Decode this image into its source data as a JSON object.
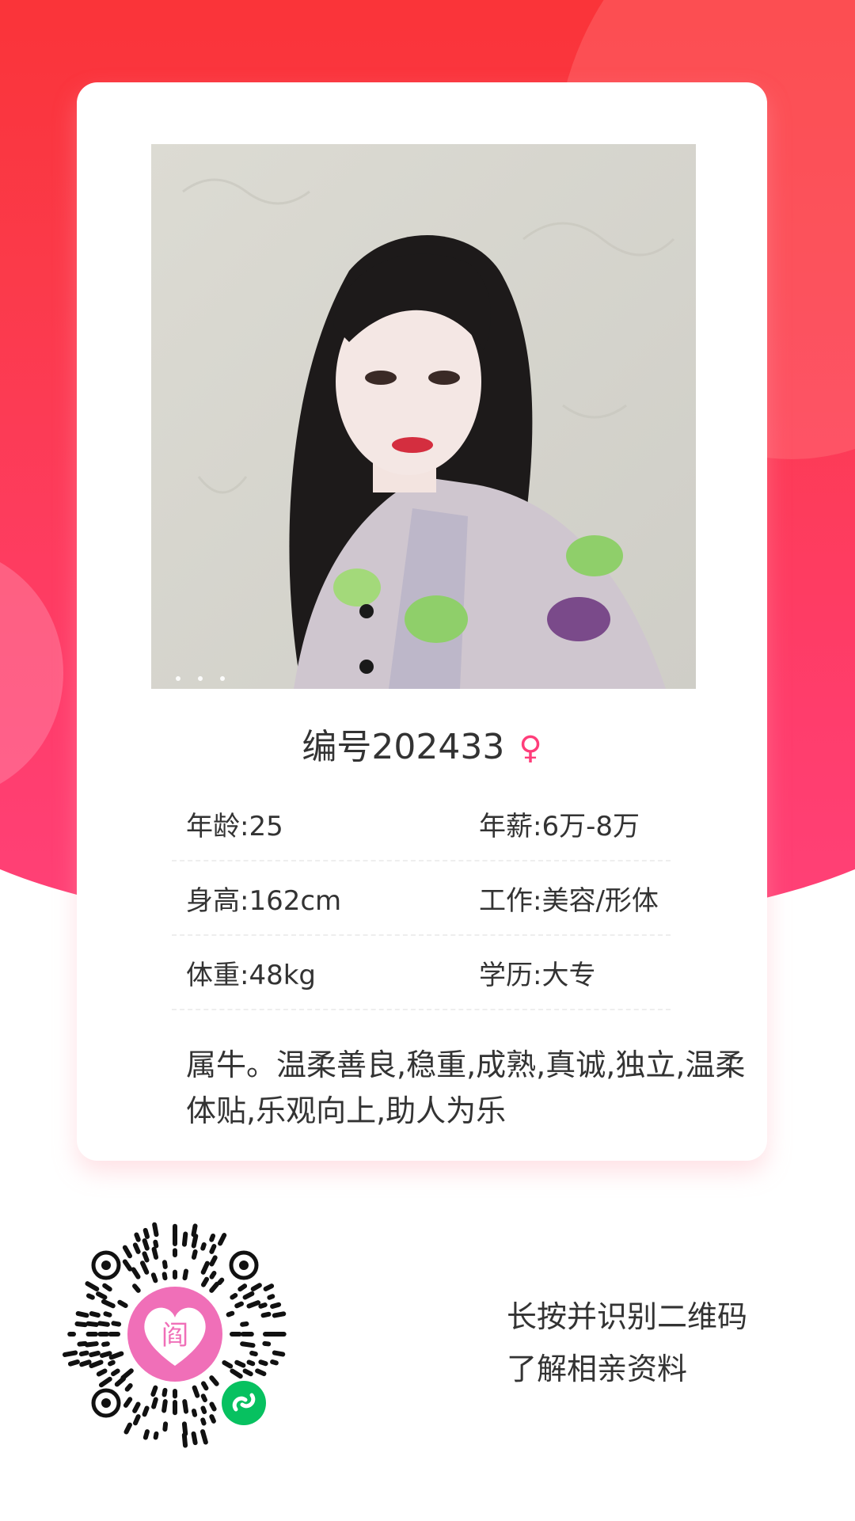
{
  "profile": {
    "title": "编号202433",
    "gender_symbol": "♀",
    "info": [
      {
        "left": "年龄:25",
        "right": "年薪:6万-8万"
      },
      {
        "left": "身高:162cm",
        "right": "工作:美容/形体"
      },
      {
        "left": "体重:48kg",
        "right": "学历:大专"
      }
    ],
    "description": "属牛。温柔善良,稳重,成熟,真诚,独立,温柔体贴,乐观向上,助人为乐"
  },
  "qr": {
    "center_glyph": "阎"
  },
  "footer": {
    "line1": "长按并识别二维码",
    "line2": "了解相亲资料"
  },
  "colors": {
    "accent": "#ff3d7a",
    "header_top": "#f9302f",
    "header_bottom": "#ff4178",
    "wechat_green": "#07c160"
  }
}
